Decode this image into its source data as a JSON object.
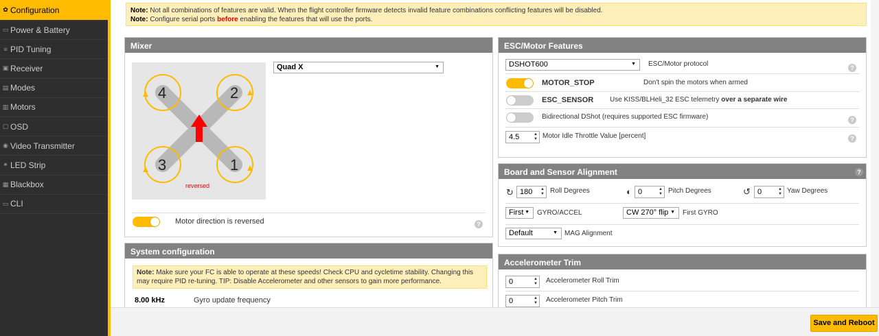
{
  "sidebar": {
    "items": [
      {
        "label": "Configuration",
        "icon": "gear-icon",
        "active": true
      },
      {
        "label": "Power & Battery",
        "icon": "battery-icon"
      },
      {
        "label": "PID Tuning",
        "icon": "sliders-icon"
      },
      {
        "label": "Receiver",
        "icon": "receiver-icon"
      },
      {
        "label": "Modes",
        "icon": "modes-icon"
      },
      {
        "label": "Motors",
        "icon": "motor-icon"
      },
      {
        "label": "OSD",
        "icon": "osd-icon"
      },
      {
        "label": "Video Transmitter",
        "icon": "antenna-icon"
      },
      {
        "label": "LED Strip",
        "icon": "led-icon"
      },
      {
        "label": "Blackbox",
        "icon": "blackbox-icon"
      },
      {
        "label": "CLI",
        "icon": "terminal-icon"
      }
    ]
  },
  "note_top": {
    "line1_bold": "Note:",
    "line1": " Not all combinations of features are valid. When the flight controller firmware detects invalid feature combinations conflicting features will be disabled.",
    "line2_bold": "Note:",
    "line2_a": " Configure serial ports ",
    "line2_red": "before",
    "line2_b": " enabling the features that will use the ports."
  },
  "mixer": {
    "title": "Mixer",
    "type": "Quad X",
    "motors": [
      "4",
      "2",
      "3",
      "1"
    ],
    "reversed_label": "reversed",
    "direction_label": "Motor direction is reversed",
    "direction_on": true
  },
  "system": {
    "title": "System configuration",
    "note_bold": "Note:",
    "note": " Make sure your FC is able to operate at these speeds! Check CPU and cycletime stability. Changing this may require PID re-tuning. TIP: Disable Accelerometer and other sensors to gain more performance.",
    "gyro_rate": "8.00 kHz",
    "gyro_label": "Gyro update frequency"
  },
  "esc": {
    "title": "ESC/Motor Features",
    "protocol": "DSHOT600",
    "protocol_label": "ESC/Motor protocol",
    "motor_stop": "MOTOR_STOP",
    "motor_stop_desc": "Don't spin the motors when armed",
    "esc_sensor": "ESC_SENSOR",
    "esc_sensor_desc_a": "Use KISS/BLHeli_32 ESC telemetry ",
    "esc_sensor_desc_b": "over a separate wire",
    "bidir": "Bidirectional DShot (requires supported ESC firmware)",
    "idle_value": "4.5",
    "idle_label": "Motor Idle Throttle Value [percent]"
  },
  "alignment": {
    "title": "Board and Sensor Alignment",
    "roll": "180",
    "roll_label": "Roll Degrees",
    "pitch": "0",
    "pitch_label": "Pitch Degrees",
    "yaw": "0",
    "yaw_label": "Yaw Degrees",
    "gyro_sel": "First",
    "gyro_label": "GYRO/ACCEL",
    "gyro_align": "CW 270° flip",
    "first_gyro_label": "First GYRO",
    "mag": "Default",
    "mag_label": "MAG Alignment"
  },
  "acc_trim": {
    "title": "Accelerometer Trim",
    "roll": "0",
    "roll_label": "Accelerometer Roll Trim",
    "pitch": "0",
    "pitch_label": "Accelerometer Pitch Trim"
  },
  "footer": {
    "save": "Save and Reboot"
  },
  "colors": {
    "accent": "#ffbb00",
    "panel_header": "#828282",
    "note_bg": "#ffefbb",
    "motor_ring": "#ffbb00",
    "arrow": "#ff0000"
  }
}
